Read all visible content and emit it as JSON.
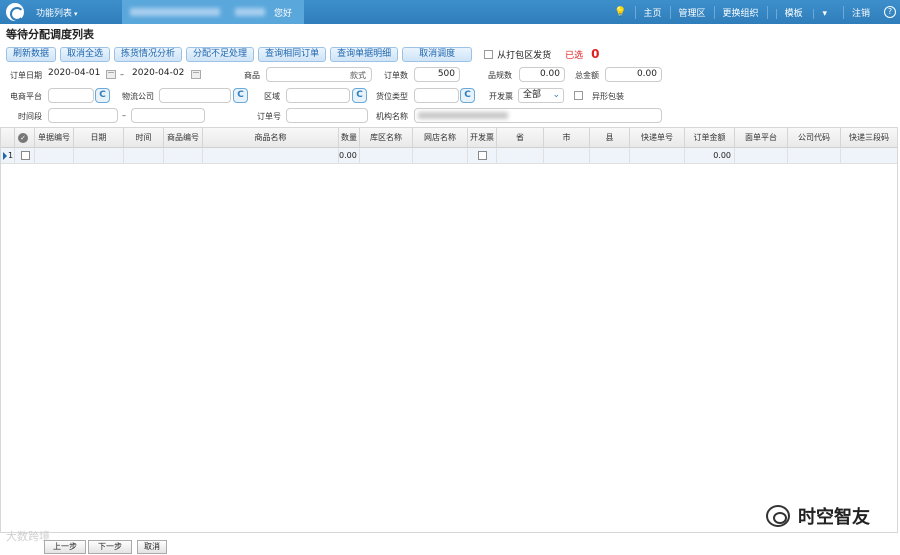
{
  "topbar": {
    "func_menu": "功能列表",
    "greeting": "您好",
    "nav": [
      "主页",
      "管理区",
      "更换组织",
      "模板",
      "注销"
    ],
    "help": "?"
  },
  "page_title": "等待分配调度列表",
  "toolbar": {
    "buttons": [
      "刷新数据",
      "取消全选",
      "拣货情况分析",
      "分配不足处理",
      "查询相同订单",
      "查询单据明细",
      "取消调度"
    ],
    "from_pack_label": "从打包区发货",
    "selected_label": "已选",
    "selected_count": "0"
  },
  "form": {
    "order_date_label": "订单日期",
    "date_from": "2020-04-01",
    "dash": "–",
    "date_to": "2020-04-02",
    "goods_label": "商品",
    "goods_btn": "款式",
    "order_count_label": "订单数",
    "order_count": "500",
    "sku_count_label": "品规数",
    "sku_count": "0.00",
    "total_amount_label": "总金额",
    "total_amount": "0.00",
    "platform_label": "电商平台",
    "logistics_label": "物流公司",
    "region_label": "区域",
    "slot_type_label": "货位类型",
    "invoice_label": "开发票",
    "invoice_value": "全部",
    "odd_pack_label": "异形包装",
    "time_label": "时间段",
    "order_no_label": "订单号",
    "org_label": "机构名称",
    "c_btn": "C"
  },
  "grid": {
    "columns": [
      "单据编号",
      "日期",
      "时间",
      "商品编号",
      "商品名称",
      "数量",
      "库区名称",
      "网店名称",
      "开发票",
      "省",
      "市",
      "县",
      "快递单号",
      "订单金额",
      "面单平台",
      "公司代码",
      "快递三段码"
    ],
    "row_index": "1",
    "row": {
      "qty": "0.00",
      "amount": "0.00"
    }
  },
  "footer": {
    "prev": "上一步",
    "next": "下一步",
    "cancel": "取消"
  },
  "watermark": {
    "brand": "时空智友",
    "left_text": "大数跨境"
  }
}
